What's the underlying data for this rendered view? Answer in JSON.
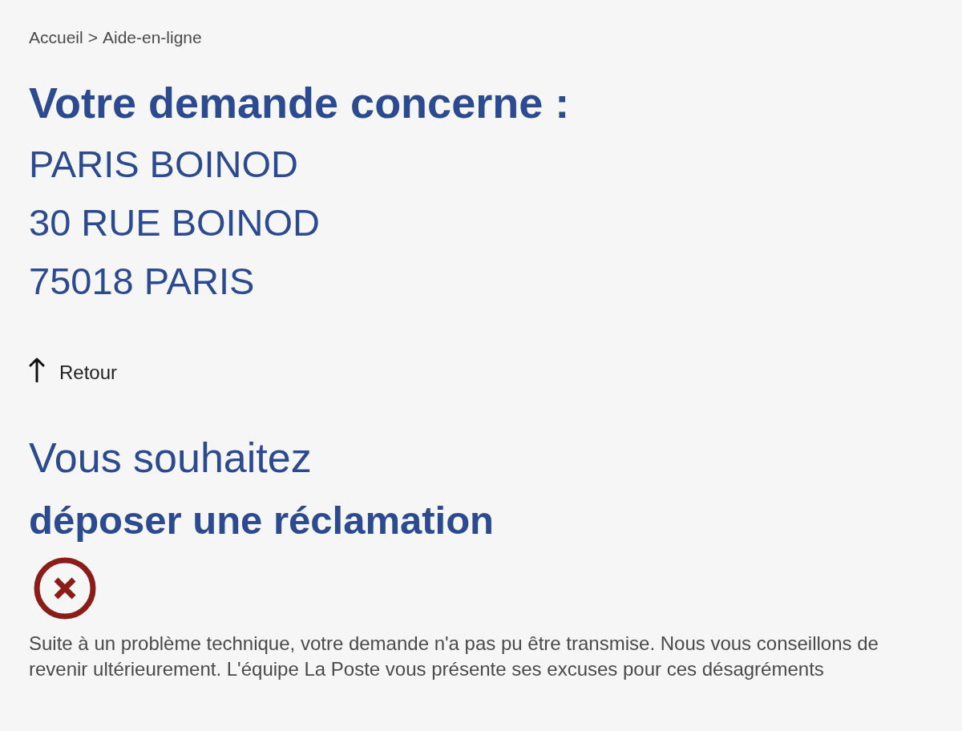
{
  "breadcrumb": {
    "items": [
      "Accueil",
      "Aide-en-ligne"
    ],
    "separator": ">"
  },
  "heading": "Votre demande concerne :",
  "address": [
    "PARIS BOINOD",
    "30 RUE BOINOD",
    "75018 PARIS"
  ],
  "back_link": {
    "label": "Retour"
  },
  "request": {
    "intro": "Vous souhaitez",
    "type": "déposer une réclamation"
  },
  "status": {
    "kind": "error",
    "message": "Suite à un problème technique, votre demande n'a pas pu être transmise. Nous vous conseillons de revenir ultérieurement. L'équipe La Poste vous présente ses excuses pour ces désagréments"
  }
}
